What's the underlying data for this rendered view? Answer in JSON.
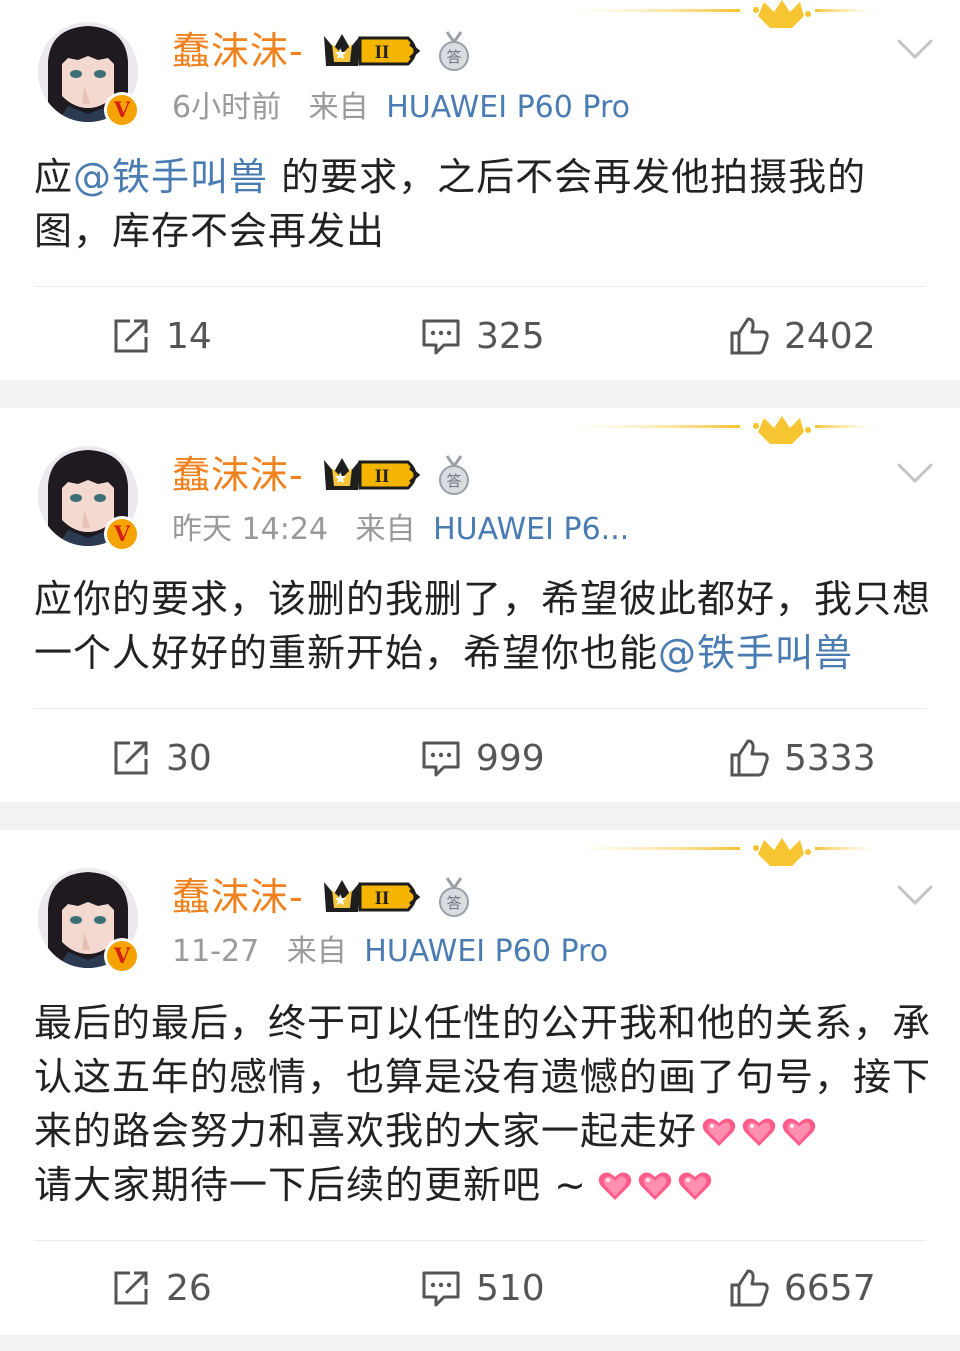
{
  "posts": [
    {
      "username": "蠢沫沫-",
      "level": "II",
      "time": "6小时前",
      "source_label": "来自",
      "device": "HUAWEI P60 Pro",
      "content_parts": [
        {
          "text": "应",
          "type": "text"
        },
        {
          "text": "@铁手叫兽",
          "type": "mention"
        },
        {
          "text": " 的要求，之后不会再发他拍摄我的图，库存不会再发出",
          "type": "text"
        }
      ],
      "hearts_inline": [],
      "reposts": "14",
      "comments": "325",
      "likes": "2402"
    },
    {
      "username": "蠢沫沫-",
      "level": "II",
      "time": "昨天 14:24",
      "source_label": "来自",
      "device": "HUAWEI P6...",
      "content_parts": [
        {
          "text": "应你的要求，该删的我删了，希望彼此都好，我只想一个人好好的重新开始，希望你也能",
          "type": "text"
        },
        {
          "text": "@铁手叫兽",
          "type": "mention"
        }
      ],
      "reposts": "30",
      "comments": "999",
      "likes": "5333"
    },
    {
      "username": "蠢沫沫-",
      "level": "II",
      "time": "11-27",
      "source_label": "来自",
      "device": "HUAWEI P60 Pro",
      "content_line1": "最后的最后，终于可以任性的公开我和他的关系，承认这五年的感情，也算是没有遗憾的画了句号，接下来的路会努力和喜欢我的大家一起走好",
      "content_line2": "请大家期待一下后续的更新吧 ~",
      "reposts": "26",
      "comments": "510",
      "likes": "6657"
    }
  ],
  "colors": {
    "username": "#f0821e",
    "link": "#4a7cb2",
    "meta": "#9a9a9a",
    "background": "#f2f2f2"
  },
  "icons": [
    "repost-icon",
    "comment-icon",
    "like-icon",
    "more-chevron-icon",
    "verified-icon",
    "crown-decoration-icon",
    "heart-emoji-icon"
  ]
}
